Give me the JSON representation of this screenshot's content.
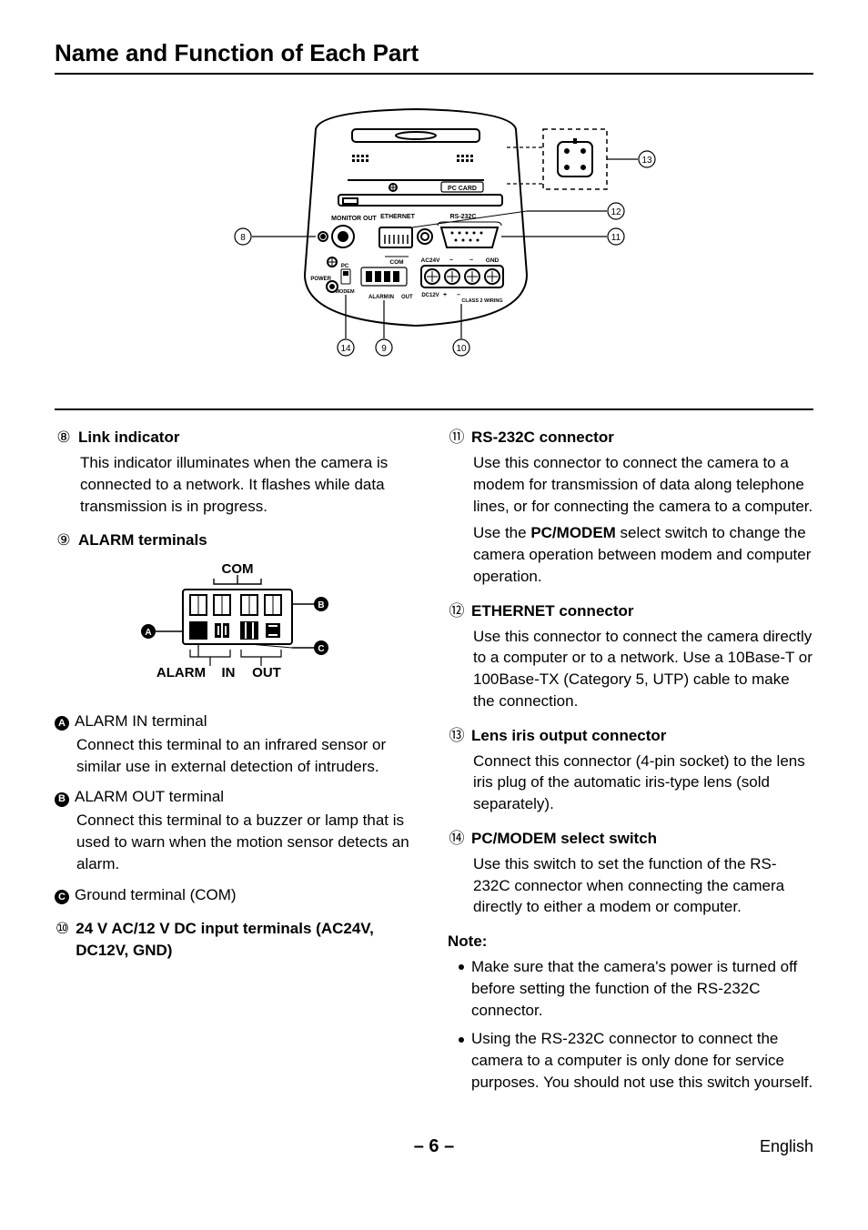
{
  "title": "Name and Function of Each Part",
  "footer": {
    "page": "– 6 –",
    "lang": "English"
  },
  "diagram": {
    "labels": {
      "pc_card": "PC CARD",
      "monitor_out": "MONITOR OUT",
      "ethernet": "ETHERNET",
      "rs232c": "RS-232C",
      "com": "COM",
      "ac24v": "AC24V",
      "tilde1": "~",
      "tilde2": "~",
      "gnd": "GND",
      "pc": "PC",
      "power": "POWER",
      "modem": "MODEM",
      "alarm": "ALARM",
      "in": "IN",
      "out": "OUT",
      "dc12v": "DC12V",
      "plus": "+",
      "minus": "–",
      "class2": "CLASS 2 WIRING"
    },
    "callouts": {
      "c8": "8",
      "c9": "9",
      "c10": "10",
      "c11": "11",
      "c12": "12",
      "c13": "13",
      "c14": "14"
    }
  },
  "alarm_fig": {
    "com": "COM",
    "alarm": "ALARM",
    "in": "IN",
    "out": "OUT",
    "A": "A",
    "B": "B",
    "C": "C"
  },
  "items": {
    "i8": {
      "num": "⑧",
      "title": "Link indicator",
      "body": "This indicator illuminates when the camera is connected to a network. It flashes while data transmission is in progress."
    },
    "i9": {
      "num": "⑨",
      "title": "ALARM terminals",
      "subA": {
        "letter": "A",
        "title": "ALARM IN terminal",
        "body": "Connect this terminal to an infrared sensor or similar use in external detection of intruders."
      },
      "subB": {
        "letter": "B",
        "title": "ALARM OUT terminal",
        "body": "Connect this terminal to a buzzer or lamp that is used to warn when the motion sensor detects an alarm."
      },
      "subC": {
        "letter": "C",
        "title": "Ground terminal (COM)"
      }
    },
    "i10": {
      "num": "⑩",
      "title": "24 V AC/12 V DC input terminals (AC24V, DC12V, GND)"
    },
    "i11": {
      "num": "⑪",
      "title": "RS-232C connector",
      "body1": "Use this connector to connect the camera to a modem for transmission of data along telephone lines, or for connecting the camera to a computer.",
      "body2a": "Use the ",
      "body2bold": "PC/MODEM",
      "body2b": " select switch to change the camera operation between modem and computer operation."
    },
    "i12": {
      "num": "⑫",
      "title": "ETHERNET connector",
      "body": "Use this connector to connect the camera directly to a computer or to a network. Use a 10Base-T or 100Base-TX (Category 5, UTP) cable to make the connection."
    },
    "i13": {
      "num": "⑬",
      "title": "Lens iris output connector",
      "body": "Connect this connector (4-pin socket) to the lens iris plug of the automatic iris-type lens (sold separately)."
    },
    "i14": {
      "num": "⑭",
      "title": "PC/MODEM select switch",
      "body": "Use this switch to set the function of the RS-232C connector when connecting the camera directly to either a modem or computer."
    }
  },
  "note": {
    "title": "Note:",
    "n1": "Make sure that the camera's power is turned off before setting the function of the RS-232C connector.",
    "n2": "Using the RS-232C connector to connect the camera to a computer is only done for service purposes. You should not use this switch yourself."
  }
}
